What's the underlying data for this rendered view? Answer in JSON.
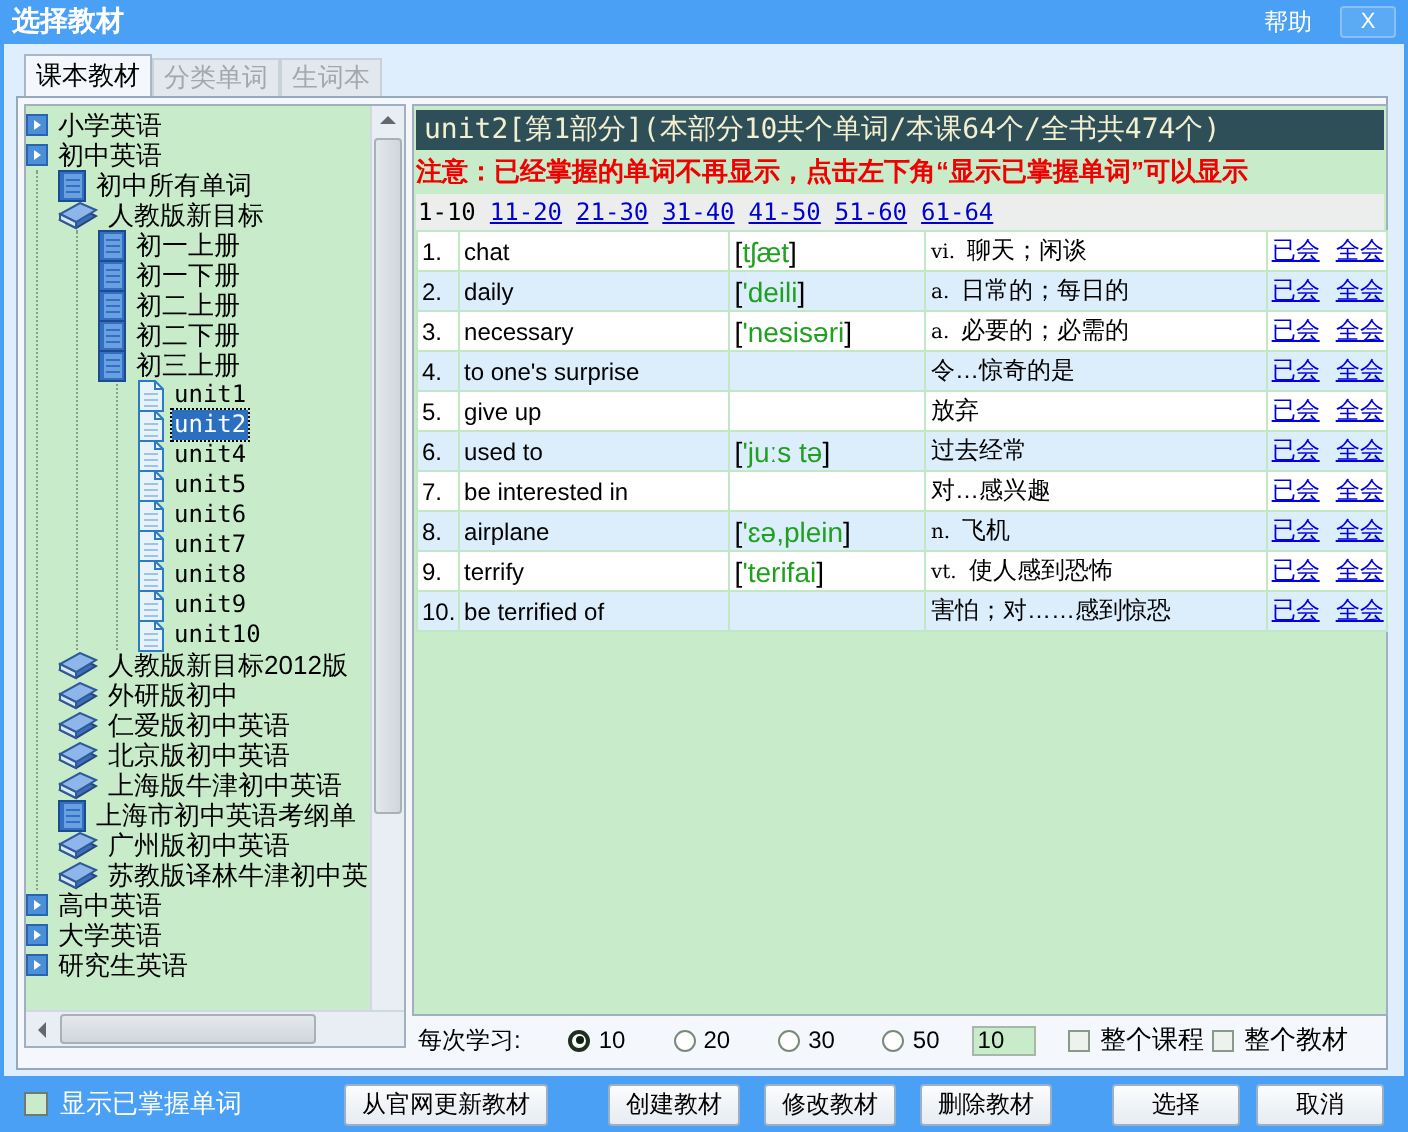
{
  "window": {
    "title": "选择教材",
    "help": "帮助",
    "close": "X"
  },
  "tabs": [
    {
      "label": "课本教材",
      "selected": true
    },
    {
      "label": "分类单词",
      "selected": false
    },
    {
      "label": "生词本",
      "selected": false
    }
  ],
  "tree": [
    {
      "label": "小学英语",
      "kind": "expander",
      "selected": false
    },
    {
      "label": "初中英语",
      "kind": "expander",
      "selected": false,
      "children": [
        {
          "label": "初中所有单词",
          "kind": "book",
          "selected": false
        },
        {
          "label": "人教版新目标",
          "kind": "books",
          "selected": false,
          "children": [
            {
              "label": "初一上册",
              "kind": "book",
              "selected": false
            },
            {
              "label": "初一下册",
              "kind": "book",
              "selected": false
            },
            {
              "label": "初二上册",
              "kind": "book",
              "selected": false
            },
            {
              "label": "初二下册",
              "kind": "book",
              "selected": false
            },
            {
              "label": "初三上册",
              "kind": "book",
              "selected": false,
              "children": [
                {
                  "label": "unit1",
                  "kind": "page",
                  "selected": false
                },
                {
                  "label": "unit2",
                  "kind": "page",
                  "selected": true
                },
                {
                  "label": "unit4",
                  "kind": "page",
                  "selected": false
                },
                {
                  "label": "unit5",
                  "kind": "page",
                  "selected": false
                },
                {
                  "label": "unit6",
                  "kind": "page",
                  "selected": false
                },
                {
                  "label": "unit7",
                  "kind": "page",
                  "selected": false
                },
                {
                  "label": "unit8",
                  "kind": "page",
                  "selected": false
                },
                {
                  "label": "unit9",
                  "kind": "page",
                  "selected": false
                },
                {
                  "label": "unit10",
                  "kind": "page",
                  "selected": false
                }
              ]
            }
          ]
        },
        {
          "label": "人教版新目标2012版",
          "kind": "books",
          "selected": false
        },
        {
          "label": "外研版初中",
          "kind": "books",
          "selected": false
        },
        {
          "label": "仁爱版初中英语",
          "kind": "books",
          "selected": false
        },
        {
          "label": "北京版初中英语",
          "kind": "books",
          "selected": false
        },
        {
          "label": "上海版牛津初中英语",
          "kind": "books",
          "selected": false
        },
        {
          "label": "上海市初中英语考纲单",
          "kind": "book",
          "selected": false
        },
        {
          "label": "广州版初中英语",
          "kind": "books",
          "selected": false
        },
        {
          "label": "苏教版译林牛津初中英",
          "kind": "books",
          "selected": false
        }
      ]
    },
    {
      "label": "高中英语",
      "kind": "expander",
      "selected": false
    },
    {
      "label": "大学英语",
      "kind": "expander",
      "selected": false
    },
    {
      "label": "研究生英语",
      "kind": "expander",
      "selected": false
    }
  ],
  "lesson": {
    "header": "unit2[第1部分](本部分10共个单词/本课64个/全书共474个)",
    "notice": "注意：已经掌握的单词不再显示，点击左下角“显示已掌握单词”可以显示",
    "pages": [
      {
        "label": "1-10",
        "selected": true
      },
      {
        "label": "11-20",
        "selected": false
      },
      {
        "label": "21-30",
        "selected": false
      },
      {
        "label": "31-40",
        "selected": false
      },
      {
        "label": "41-50",
        "selected": false
      },
      {
        "label": "51-60",
        "selected": false
      },
      {
        "label": "61-64",
        "selected": false
      }
    ],
    "words": [
      {
        "number": "1.",
        "word": "chat",
        "phonetic": "[tʃæt]",
        "pos": "vi.",
        "meaning": "聊天；闲谈",
        "actions": [
          "已会",
          "全会"
        ]
      },
      {
        "number": "2.",
        "word": "daily",
        "phonetic": "['deili]",
        "pos": "a.",
        "meaning": "日常的；每日的",
        "actions": [
          "已会",
          "全会"
        ]
      },
      {
        "number": "3.",
        "word": "necessary",
        "phonetic": "['nesisəri]",
        "pos": "a.",
        "meaning": "必要的；必需的",
        "actions": [
          "已会",
          "全会"
        ]
      },
      {
        "number": "4.",
        "word": "to one's surprise",
        "meaning": "令…惊奇的是",
        "actions": [
          "已会",
          "全会"
        ]
      },
      {
        "number": "5.",
        "word": "give up",
        "meaning": "放弃",
        "actions": [
          "已会",
          "全会"
        ]
      },
      {
        "number": "6.",
        "word": "used to",
        "phonetic": "['juːs tə]",
        "meaning": "过去经常",
        "actions": [
          "已会",
          "全会"
        ]
      },
      {
        "number": "7.",
        "word": "be interested in",
        "meaning": "对…感兴趣",
        "actions": [
          "已会",
          "全会"
        ]
      },
      {
        "number": "8.",
        "word": "airplane",
        "phonetic": "['ɛə,plein]",
        "pos": "n.",
        "meaning": "飞机",
        "actions": [
          "已会",
          "全会"
        ]
      },
      {
        "number": "9.",
        "word": "terrify",
        "phonetic": "['terifai]",
        "pos": "vt.",
        "meaning": "使人感到恐怖",
        "actions": [
          "已会",
          "全会"
        ]
      },
      {
        "number": "10.",
        "word": "be terrified of",
        "meaning": "害怕；对……感到惊恐",
        "actions": [
          "已会",
          "全会"
        ]
      }
    ]
  },
  "study": {
    "label": "每次学习:",
    "options": [
      {
        "label": "10",
        "selected": true
      },
      {
        "label": "20",
        "selected": false
      },
      {
        "label": "30",
        "selected": false
      },
      {
        "label": "50",
        "selected": false
      }
    ],
    "count": "10",
    "checks": [
      {
        "label": "整个课程",
        "checked": false
      },
      {
        "label": "整个教材",
        "checked": false
      }
    ]
  },
  "footer": {
    "show_mastered": {
      "label": "显示已掌握单词",
      "checked": false
    },
    "button_groups": [
      [
        "从官网更新教材"
      ],
      [
        "创建教材",
        "修改教材",
        "删除教材"
      ],
      [
        "选择",
        "取消"
      ]
    ]
  }
}
